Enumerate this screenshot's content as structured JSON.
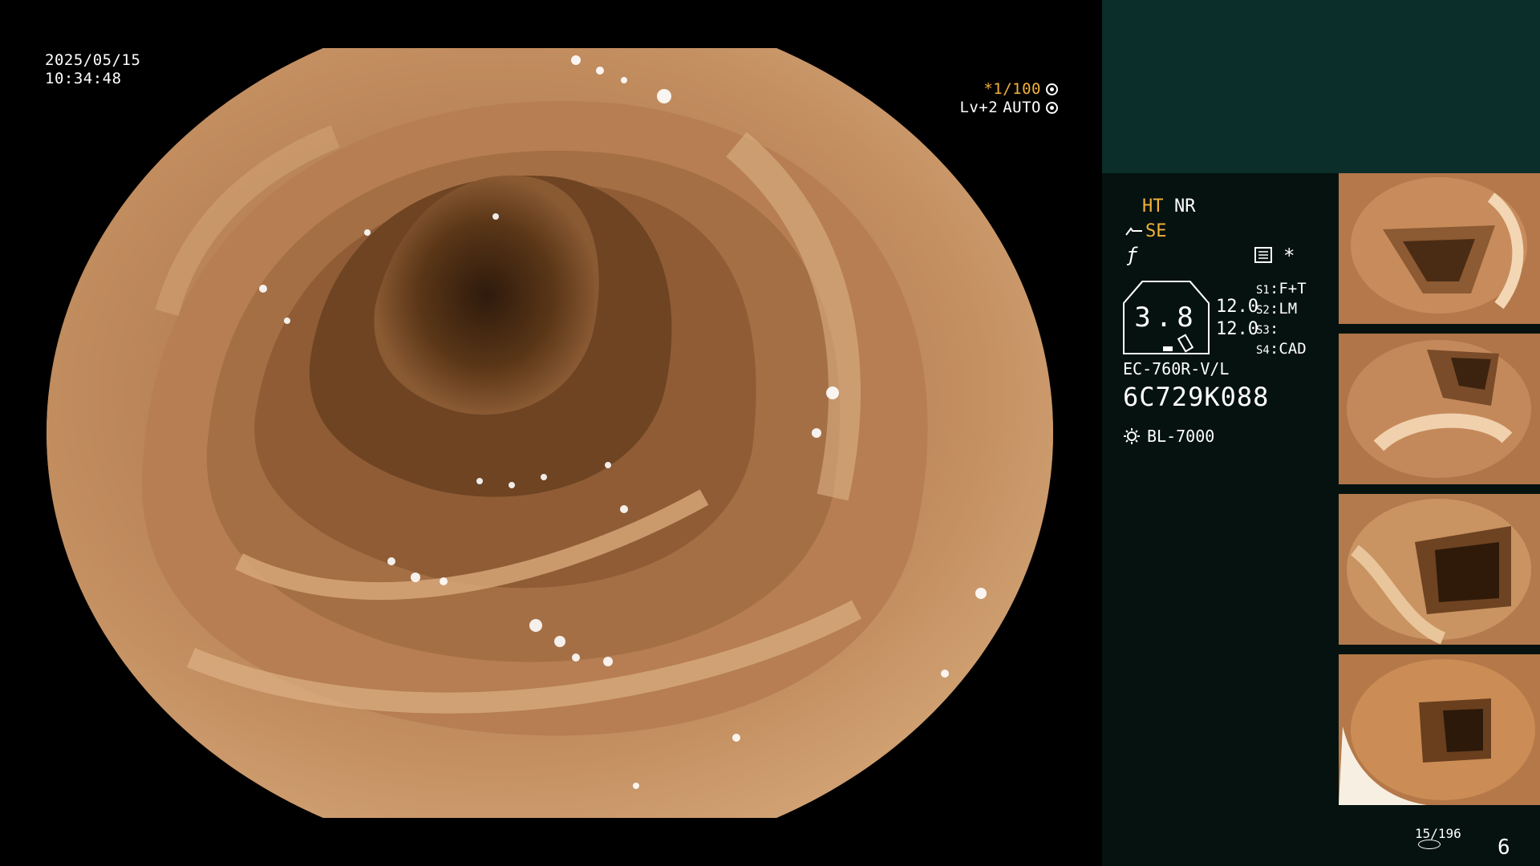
{
  "overlay": {
    "date": "2025/05/15",
    "time": "10:34:48",
    "shutter": "*1/100",
    "shutter_icon": "aperture-icon",
    "level": "Lv+2",
    "iris": "AUTO",
    "iris_icon": "iris-icon"
  },
  "status": {
    "ht": "HT",
    "nr": "NR",
    "se": "SE",
    "memory_icon": "memory-icon",
    "star": "*",
    "zoom_value": "3.8",
    "value_1": "12.0",
    "value_2": "12.0",
    "slots": [
      {
        "key": "S1",
        "value": "F+T"
      },
      {
        "key": "S2",
        "value": "LM"
      },
      {
        "key": "S3",
        "value": ""
      },
      {
        "key": "S4",
        "value": "CAD"
      }
    ],
    "scope_model": "EC-760R-V/L",
    "serial": "6C729K088",
    "light_source": "BL-7000"
  },
  "counters": {
    "frame": "15/196",
    "page": "6"
  },
  "colors": {
    "accent_yellow": "#f2b23a",
    "panel_bg": "#051210",
    "panel_header": "#0b2e2a"
  }
}
